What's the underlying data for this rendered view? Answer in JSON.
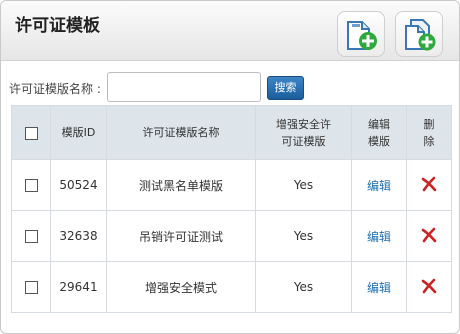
{
  "header": {
    "title": "许可证模板"
  },
  "toolbar": {
    "new_icon": "new-file-plus-icon",
    "copy_icon": "copy-file-plus-icon"
  },
  "search": {
    "label": "许可证模版名称 :",
    "value": "",
    "placeholder": "",
    "button": "搜索"
  },
  "table": {
    "columns": {
      "id": "模版ID",
      "name": "许可证模版名称",
      "enhanced_line1": "增强安全许",
      "enhanced_line2": "可证模版",
      "edit_line1": "编辑",
      "edit_line2": "模版",
      "delete_line1": "删",
      "delete_line2": "除"
    },
    "rows": [
      {
        "id": "50524",
        "name": "测试黑名单模版",
        "enhanced": "Yes",
        "edit": "编辑"
      },
      {
        "id": "32638",
        "name": "吊销许可证测试",
        "enhanced": "Yes",
        "edit": "编辑"
      },
      {
        "id": "29641",
        "name": "增强安全模式",
        "enhanced": "Yes",
        "edit": "编辑"
      }
    ]
  },
  "colors": {
    "accent": "#1f6fb2",
    "header_bg": "#dde4ea",
    "delete": "#cc2222",
    "plus": "#2eaa3c"
  }
}
